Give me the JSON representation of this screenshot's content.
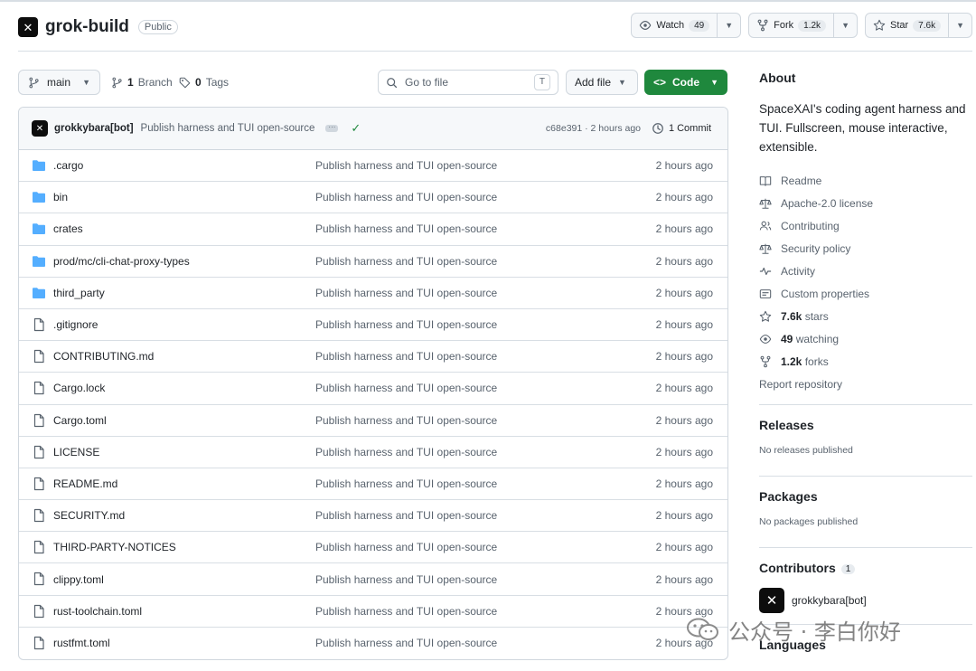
{
  "repo": {
    "name": "grok-build",
    "visibility": "Public",
    "watch": {
      "label": "Watch",
      "count": "49"
    },
    "fork": {
      "label": "Fork",
      "count": "1.2k"
    },
    "star": {
      "label": "Star",
      "count": "7.6k"
    }
  },
  "toolbar": {
    "branch": "main",
    "branches_count": "1",
    "branches_label": "Branch",
    "tags_count": "0",
    "tags_label": "Tags",
    "search_placeholder": "Go to file",
    "search_shortcut": "T",
    "add_file": "Add file",
    "code": "Code"
  },
  "latest_commit": {
    "author": "grokkybara[bot]",
    "message": "Publish harness and TUI open-source",
    "hash_time": "c68e391 · 2 hours ago",
    "commits": "1 Commit"
  },
  "files": [
    {
      "type": "dir",
      "name": ".cargo",
      "message": "Publish harness and TUI open-source",
      "time": "2 hours ago"
    },
    {
      "type": "dir",
      "name": "bin",
      "message": "Publish harness and TUI open-source",
      "time": "2 hours ago"
    },
    {
      "type": "dir",
      "name": "crates",
      "message": "Publish harness and TUI open-source",
      "time": "2 hours ago"
    },
    {
      "type": "dir",
      "name": "prod/mc/cli-chat-proxy-types",
      "message": "Publish harness and TUI open-source",
      "time": "2 hours ago"
    },
    {
      "type": "dir",
      "name": "third_party",
      "message": "Publish harness and TUI open-source",
      "time": "2 hours ago"
    },
    {
      "type": "file",
      "name": ".gitignore",
      "message": "Publish harness and TUI open-source",
      "time": "2 hours ago"
    },
    {
      "type": "file",
      "name": "CONTRIBUTING.md",
      "message": "Publish harness and TUI open-source",
      "time": "2 hours ago"
    },
    {
      "type": "file",
      "name": "Cargo.lock",
      "message": "Publish harness and TUI open-source",
      "time": "2 hours ago"
    },
    {
      "type": "file",
      "name": "Cargo.toml",
      "message": "Publish harness and TUI open-source",
      "time": "2 hours ago"
    },
    {
      "type": "file",
      "name": "LICENSE",
      "message": "Publish harness and TUI open-source",
      "time": "2 hours ago"
    },
    {
      "type": "file",
      "name": "README.md",
      "message": "Publish harness and TUI open-source",
      "time": "2 hours ago"
    },
    {
      "type": "file",
      "name": "SECURITY.md",
      "message": "Publish harness and TUI open-source",
      "time": "2 hours ago"
    },
    {
      "type": "file",
      "name": "THIRD-PARTY-NOTICES",
      "message": "Publish harness and TUI open-source",
      "time": "2 hours ago"
    },
    {
      "type": "file",
      "name": "clippy.toml",
      "message": "Publish harness and TUI open-source",
      "time": "2 hours ago"
    },
    {
      "type": "file",
      "name": "rust-toolchain.toml",
      "message": "Publish harness and TUI open-source",
      "time": "2 hours ago"
    },
    {
      "type": "file",
      "name": "rustfmt.toml",
      "message": "Publish harness and TUI open-source",
      "time": "2 hours ago"
    }
  ],
  "about": {
    "heading": "About",
    "description": "SpaceXAI's coding agent harness and TUI. Fullscreen, mouse interactive, extensible.",
    "readme": "Readme",
    "license": "Apache-2.0 license",
    "contributing": "Contributing",
    "security": "Security policy",
    "activity": "Activity",
    "custom_properties": "Custom properties",
    "stars_count": "7.6k",
    "stars_label": "stars",
    "watching_count": "49",
    "watching_label": "watching",
    "forks_count": "1.2k",
    "forks_label": "forks",
    "report": "Report repository"
  },
  "releases": {
    "heading": "Releases",
    "empty": "No releases published"
  },
  "packages": {
    "heading": "Packages",
    "empty": "No packages published"
  },
  "contributors": {
    "heading": "Contributors",
    "count": "1",
    "name": "grokkybara[bot]"
  },
  "languages": {
    "heading": "Languages"
  },
  "watermark": {
    "text": "公众号 · 李白你好"
  },
  "colors": {
    "accent_green": "#1f883d",
    "folder_blue": "#54aeff",
    "muted_text": "#59636e"
  }
}
